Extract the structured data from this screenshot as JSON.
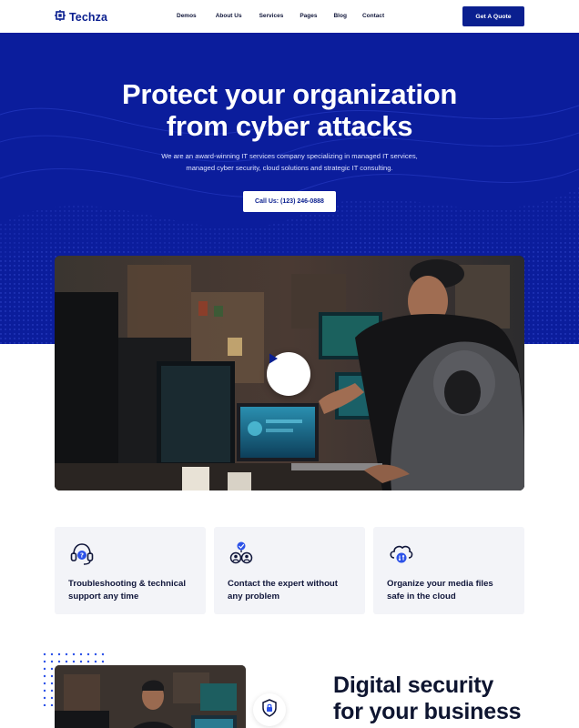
{
  "brand": {
    "name": "Techza",
    "color": "#0a1f8f"
  },
  "nav": {
    "links": [
      "Demos",
      "About Us",
      "Services",
      "Pages",
      "Blog",
      "Contact"
    ],
    "cta": "Get A Quote"
  },
  "hero": {
    "title_line1": "Protect your organization",
    "title_line2": "from cyber attacks",
    "subtitle_line1": "We are an award-winning IT services company specializing in managed IT services,",
    "subtitle_line2": "managed cyber security, cloud solutions and strategic IT consulting.",
    "call_button": "Call Us: (123) 246-0888",
    "background": "#0b1d9c"
  },
  "video": {
    "play_icon": "play-icon"
  },
  "features": [
    {
      "icon": "headset-icon",
      "line1": "Troubleshooting & technical",
      "line2": "support any time"
    },
    {
      "icon": "expert-users-icon",
      "line1": "Contact the expert without",
      "line2": "any problem"
    },
    {
      "icon": "cloud-sync-icon",
      "line1": "Organize your media files",
      "line2": "safe in the cloud"
    }
  ],
  "about": {
    "title_line1": "Digital security",
    "title_line2": "for your business",
    "badge_icon": "shield-lock-icon"
  }
}
